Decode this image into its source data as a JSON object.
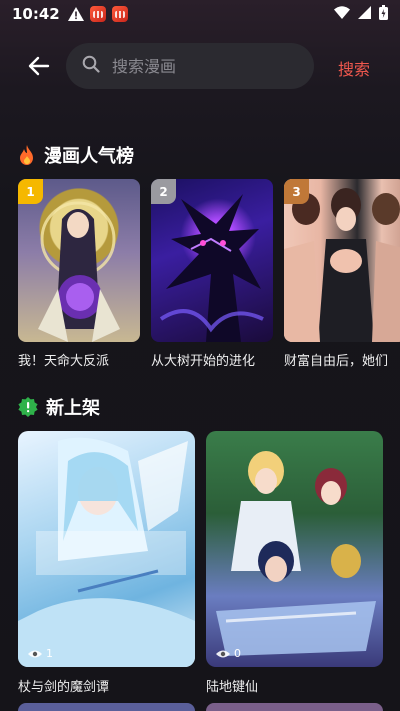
{
  "status_bar": {
    "time": "10:42"
  },
  "search": {
    "placeholder": "搜索漫画",
    "value": "",
    "action_label": "搜索"
  },
  "hot_section": {
    "title": "漫画人气榜",
    "items": [
      {
        "rank": "1",
        "name": "我！天命大反派",
        "badge_color": "#f5b800"
      },
      {
        "rank": "2",
        "name": "从大树开始的进化",
        "badge_color": "#9a9aa0"
      },
      {
        "rank": "3",
        "name": "财富自由后，她们",
        "badge_color": "#c07838"
      }
    ]
  },
  "new_section": {
    "title": "新上架",
    "items": [
      {
        "name": "杖与剑的魔剑谭",
        "views": "1"
      },
      {
        "name": "陆地键仙",
        "views": "0"
      }
    ]
  },
  "colors": {
    "accent": "#f0584e",
    "new_badge": "#2fb24a",
    "fire": "#ff6a2a"
  }
}
